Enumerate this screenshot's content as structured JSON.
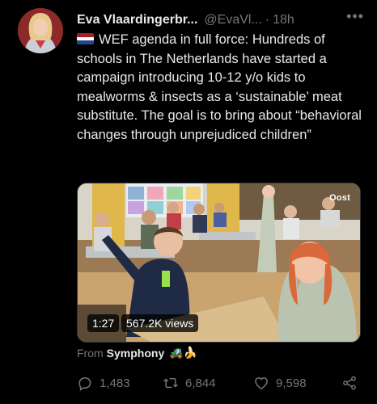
{
  "author": {
    "name": "Eva Vlaardingerbr...",
    "handle": "@EvaVl...",
    "separator": "·",
    "time": "18h"
  },
  "more_icon": "more-horizontal-icon",
  "tweet": {
    "flag_emoji": "netherlands-flag",
    "text": "WEF agenda in full force: Hundreds of schools in The Netherlands have started a campaign introducing 10-12 y/o kids to mealworms & insects as a ‘sustainable’ meat substitute. The goal is to bring about “behavioral changes through unprejudiced children”"
  },
  "media": {
    "duration": "1:27",
    "views": "567.2K views",
    "watermark": "Oost"
  },
  "source": {
    "prefix": "From",
    "name": "Symphony",
    "emojis": "🚜🍌"
  },
  "actions": {
    "replies": "1,483",
    "retweets": "6,844",
    "likes": "9,598"
  },
  "colors": {
    "background": "#000000",
    "text": "#e7e9ea",
    "muted": "#71767b"
  }
}
